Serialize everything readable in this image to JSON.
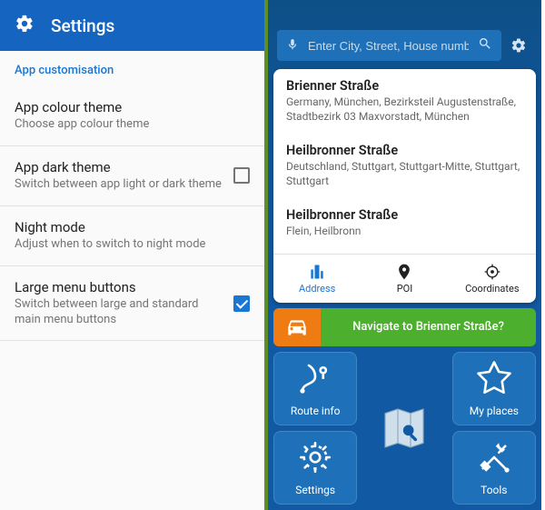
{
  "settings": {
    "title": "Settings",
    "section": "App customisation",
    "items": [
      {
        "title": "App colour theme",
        "sub": "Choose app colour theme",
        "checkbox": false
      },
      {
        "title": "App dark theme",
        "sub": "Switch between app light or dark theme",
        "checkbox": true,
        "checked": false
      },
      {
        "title": "Night mode",
        "sub": "Adjust when to switch to night mode",
        "checkbox": false
      },
      {
        "title": "Large menu buttons",
        "sub": "Switch between large and standard main menu buttons",
        "checkbox": true,
        "checked": true
      }
    ]
  },
  "search": {
    "placeholder": "Enter City, Street, House number…",
    "results": [
      {
        "title": "Brienner Straße",
        "sub": "Germany, München, Bezirksteil Augustenstraße, Stadtbezirk 03 Maxvorstadt, München"
      },
      {
        "title": "Heilbronner Straße",
        "sub": "Deutschland, Stuttgart, Stuttgart-Mitte, Stuttgart, Stuttgart"
      },
      {
        "title": "Heilbronner Straße",
        "sub": "Flein, Heilbronn"
      }
    ],
    "tabs": {
      "address": "Address",
      "poi": "POI",
      "coords": "Coordinates"
    }
  },
  "navigate": {
    "label": "Navigate to Brienner Straße?"
  },
  "tiles": {
    "route": "Route info",
    "places": "My places",
    "settings": "Settings",
    "tools": "Tools"
  }
}
